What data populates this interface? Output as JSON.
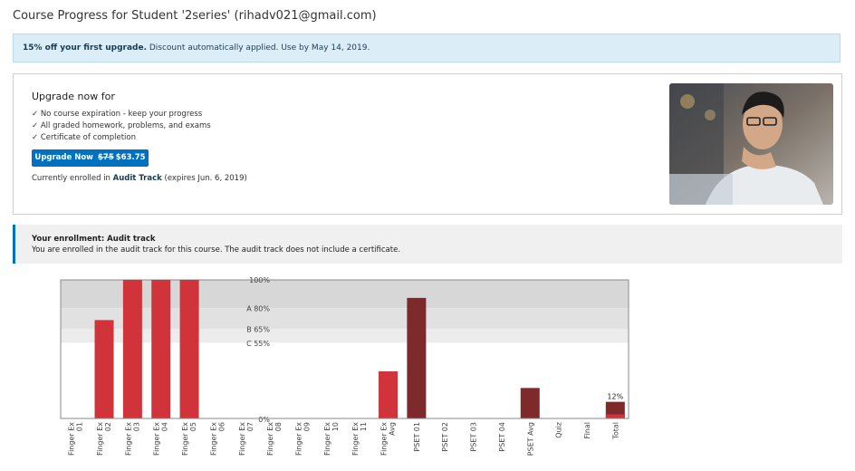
{
  "page": {
    "title": "Course Progress for Student '2series' (rihadv021@gmail.com)"
  },
  "promo": {
    "bold": "15% off your first upgrade.",
    "text": " Discount automatically applied. Use by May 14, 2019."
  },
  "upgrade": {
    "title": "Upgrade now for",
    "benefits": [
      "✓ No course expiration - keep your progress",
      "✓ All graded homework, problems, and exams",
      "✓ Certificate of completion"
    ],
    "button_prefix": "Upgrade Now",
    "button_old_price": "$75",
    "button_new_price": "$63.75",
    "status_prefix": "Currently enrolled in ",
    "status_track": "Audit Track",
    "status_suffix": " (expires Jun. 6, 2019)"
  },
  "enrollment": {
    "title": "Your enrollment: Audit track",
    "text": "You are enrolled in the audit track for this course. The audit track does not include a certificate."
  },
  "colors": {
    "bar_regular": "#d0343a",
    "bar_average": "#7e2a2c",
    "band_100": "#d7d7d7",
    "band_a": "#e1e1e1",
    "band_b": "#ececec",
    "accent": "#0070c0"
  },
  "chart_data": {
    "type": "bar",
    "ylim": [
      0,
      100
    ],
    "grade_bands": [
      {
        "label": "100%",
        "value": 100
      },
      {
        "label": "A 80%",
        "value": 80
      },
      {
        "label": "B 65%",
        "value": 65
      },
      {
        "label": "C 55%",
        "value": 55
      },
      {
        "label": "0%",
        "value": 0
      }
    ],
    "categories": [
      "Finger Ex 01",
      "Finger Ex 02",
      "Finger Ex 03",
      "Finger Ex 04",
      "Finger Ex 05",
      "Finger Ex 06",
      "Finger Ex 07",
      "Finger Ex 08",
      "Finger Ex 09",
      "Finger Ex 10",
      "Finger Ex 11",
      "Finger Ex Avg",
      "PSET 01",
      "PSET 02",
      "PSET 03",
      "PSET 04",
      "PSET Avg",
      "Quiz",
      "Final",
      "Total"
    ],
    "values": [
      0,
      71,
      100,
      100,
      100,
      0,
      0,
      0,
      0,
      0,
      0,
      34,
      87,
      0,
      0,
      0,
      22,
      0,
      0,
      12
    ],
    "kinds": [
      "regular",
      "regular",
      "regular",
      "regular",
      "regular",
      "regular",
      "regular",
      "regular",
      "regular",
      "regular",
      "regular",
      "regular",
      "average",
      "regular",
      "regular",
      "regular",
      "average",
      "regular",
      "regular",
      "total"
    ],
    "total_label": "12%",
    "total_current_value": 3
  }
}
